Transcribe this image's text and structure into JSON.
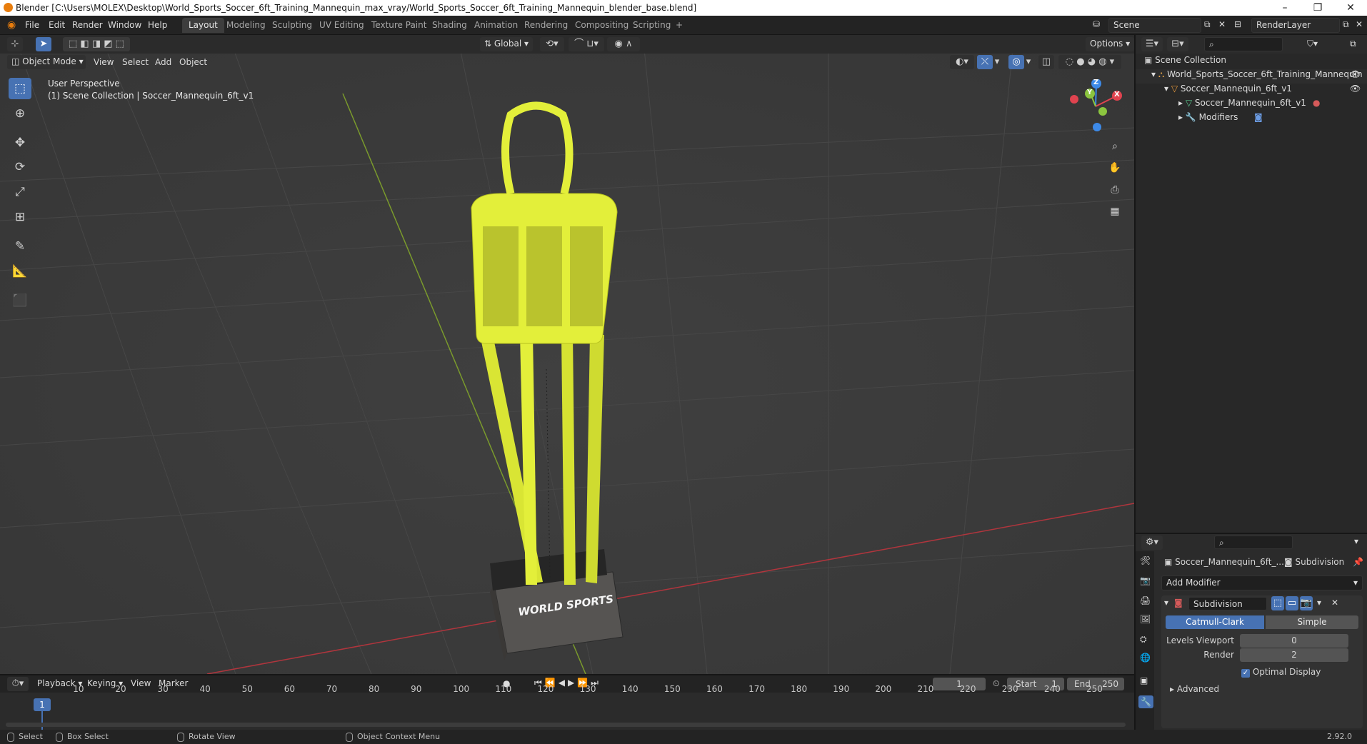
{
  "window": {
    "title": "Blender [C:\\Users\\MOLEX\\Desktop\\World_Sports_Soccer_6ft_Training_Mannequin_max_vray/World_Sports_Soccer_6ft_Training_Mannequin_blender_base.blend]",
    "controls": [
      "–",
      "❐",
      "✕"
    ]
  },
  "menu": [
    "File",
    "Edit",
    "Render",
    "Window",
    "Help"
  ],
  "workspaces": [
    "Layout",
    "Modeling",
    "Sculpting",
    "UV Editing",
    "Texture Paint",
    "Shading",
    "Animation",
    "Rendering",
    "Compositing",
    "Scripting",
    "+"
  ],
  "active_workspace": "Layout",
  "scene": {
    "label": "Scene",
    "view_layer": "RenderLayer"
  },
  "viewport": {
    "mode": "Object Mode",
    "menus": [
      "View",
      "Select",
      "Add",
      "Object"
    ],
    "orientation": "Global",
    "options_label": "Options",
    "overlay_title": "User Perspective",
    "overlay_subtitle": "(1) Scene Collection | Soccer_Mannequin_6ft_v1",
    "gizmo_axes": {
      "z": "Z",
      "y": "Y",
      "x": "X"
    },
    "mannequin_logo_text": "WORLD SPORTS"
  },
  "outliner": {
    "root": "Scene Collection",
    "rows": [
      {
        "label": "World_Sports_Soccer_6ft_Training_Mannequin",
        "icon": "collection-icon"
      },
      {
        "label": "Soccer_Mannequin_6ft_v1",
        "icon": "object-icon"
      },
      {
        "label": "Soccer_Mannequin_6ft_v1",
        "icon": "mesh-icon"
      },
      {
        "label": "Modifiers",
        "icon": "wrench-icon"
      }
    ]
  },
  "properties": {
    "object_name": "Soccer_Mannequin_6ft_...",
    "modifier_tab": "Subdivision",
    "add_modifier": "Add Modifier",
    "modifier_name": "Subdivision",
    "methods": [
      "Catmull-Clark",
      "Simple"
    ],
    "active_method": "Catmull-Clark",
    "fields": [
      {
        "label": "Levels Viewport",
        "value": "0"
      },
      {
        "label": "Render",
        "value": "2"
      }
    ],
    "optimal_display": "Optimal Display",
    "advanced": "Advanced"
  },
  "timeline": {
    "menus": [
      "Playback",
      "Keying",
      "View",
      "Marker"
    ],
    "current_frame": "1",
    "start_label": "Start",
    "start": "1",
    "end_label": "End",
    "end": "250",
    "ticks": [
      "1",
      "10",
      "20",
      "30",
      "40",
      "50",
      "60",
      "70",
      "80",
      "90",
      "100",
      "110",
      "120",
      "130",
      "140",
      "150",
      "160",
      "170",
      "180",
      "190",
      "200",
      "210",
      "220",
      "230",
      "240",
      "250"
    ]
  },
  "statusbar": {
    "select": "Select",
    "box_select": "Box Select",
    "rotate_view": "Rotate View",
    "context_menu": "Object Context Menu",
    "version": "2.92.0"
  },
  "colors": {
    "accent": "#4772b3",
    "mannequin": "#e3ef3a",
    "axis_x": "#e0434f",
    "axis_y": "#8bc53f",
    "axis_z": "#3d8ae8"
  }
}
